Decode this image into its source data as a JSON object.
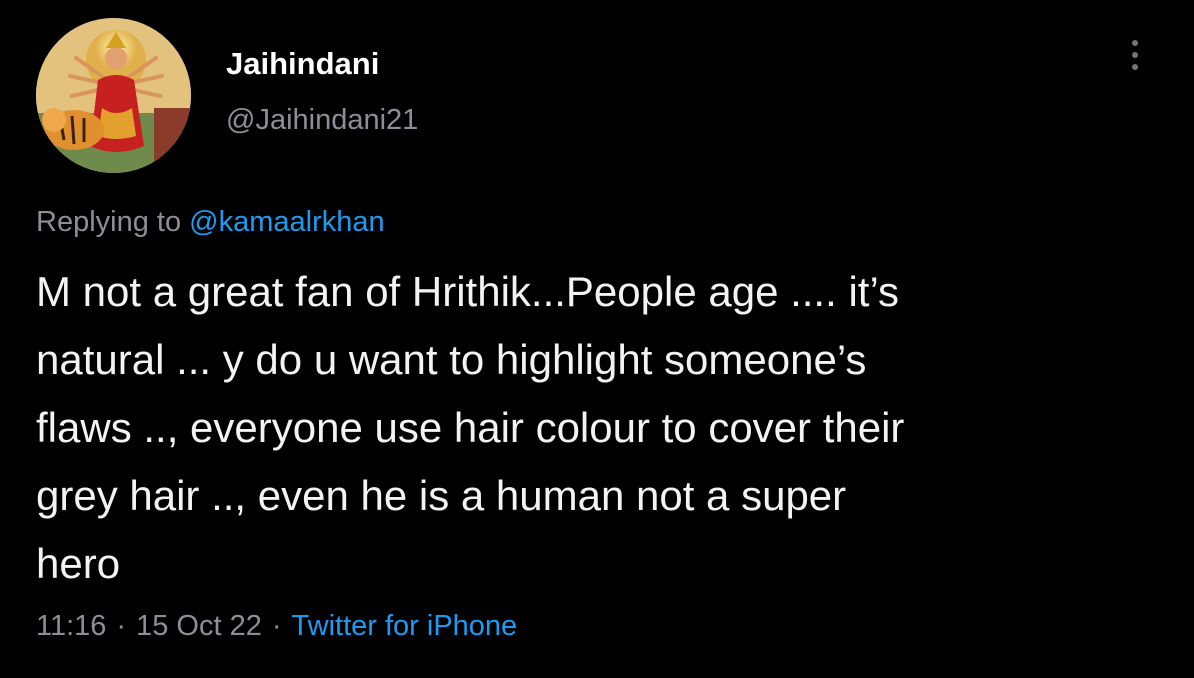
{
  "tweet": {
    "display_name": "Jaihindani",
    "handle": "@Jaihindani21",
    "avatar": "deity-painting-avatar",
    "reply_prefix": "Replying to ",
    "reply_to": "@kamaalrkhan",
    "text": "M not a great fan of Hrithik...People age .... it’s\nnatural ... y do u want to highlight someone’s\nflaws ..,  everyone use hair colour to cover their\ngrey hair .., even he is a human not a super\nhero",
    "time": "11:16",
    "separator": "·",
    "date": "15 Oct 22",
    "source": "Twitter for iPhone",
    "more_icon": "vertical-ellipsis-icon"
  },
  "colors": {
    "background": "#000000",
    "text": "#f2f3f3",
    "muted": "#8b9096",
    "link": "#1d9bf0"
  }
}
